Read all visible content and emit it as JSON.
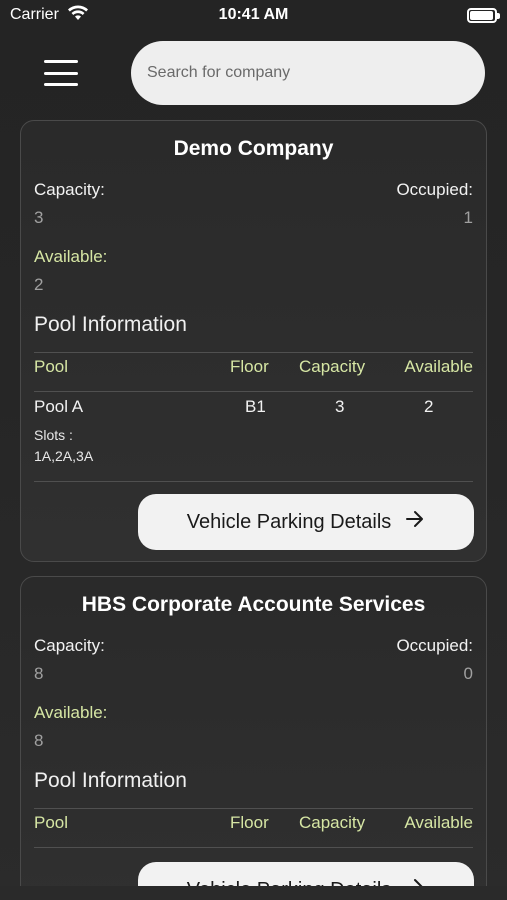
{
  "status_bar": {
    "carrier": "Carrier",
    "time": "10:41 AM",
    "battery_level": 0.95
  },
  "header": {
    "menu_icon": "hamburger-icon",
    "search_placeholder": "Search for company"
  },
  "cards": [
    {
      "title": "Demo Company",
      "capacity_label": "Capacity:",
      "capacity_value": "3",
      "occupied_label": "Occupied:",
      "occupied_value": "1",
      "available_label": "Available:",
      "available_value": "2",
      "pool_section_title": "Pool Information",
      "pool_headers": [
        "Pool",
        "Floor",
        "Capacity",
        "Available"
      ],
      "pools": [
        {
          "pool": "Pool A",
          "floor": "B1",
          "capacity": "3",
          "available": "2",
          "slots_label": "Slots :",
          "slots": "1A,2A,3A"
        }
      ],
      "button_label": "Vehicle Parking Details",
      "button_icon": "arrow-right-icon"
    },
    {
      "title": "HBS Corporate Accounte Services",
      "capacity_label": "Capacity:",
      "capacity_value": "8",
      "occupied_label": "Occupied:",
      "occupied_value": "0",
      "available_label": "Available:",
      "available_value": "8",
      "pool_section_title": "Pool Information",
      "pool_headers": [
        "Pool",
        "Floor",
        "Capacity",
        "Available"
      ],
      "button_label": "Vehicle Parking Details",
      "button_icon": "arrow-right-icon"
    }
  ],
  "colors": {
    "background": "#262626",
    "accent_green": "#d6e6a4",
    "muted_value": "#a0a0a0",
    "button_bg": "#f2f2f2"
  }
}
